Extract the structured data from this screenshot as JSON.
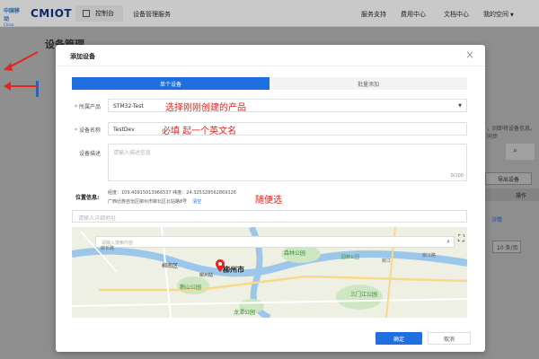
{
  "topbar": {
    "logo_line1": "中国移动",
    "logo_line2": "China Mobile",
    "brand": "CMIOT",
    "console": "控制台",
    "service": "设备管理服务",
    "nav": [
      "服务支持",
      "费用中心",
      "文档中心",
      "我的空间"
    ]
  },
  "page": {
    "title": "设备管理",
    "bg_right_texts": [
      "，则即将设备信息。同步",
      "导出设备",
      "操作",
      "详情",
      "10 条/页"
    ]
  },
  "modal": {
    "title": "添加设备",
    "close": "×",
    "tabs": [
      "单个设备",
      "批量添加"
    ],
    "product_label": "所属产品",
    "product_value": "STM32-Test",
    "device_name_label": "设备名称",
    "device_name_value": "TestDev",
    "desc_label": "设备描述",
    "desc_placeholder": "请输入描述信息",
    "desc_counter": "0/100",
    "location_label": "位置信息:",
    "coords": "经度：109.40915013966537  纬度：24.325328562869326",
    "address": "广西壮族自治区柳州市柳北区北站路8号",
    "clear": "清空",
    "address_placeholder": "请输入详细地址",
    "map_search_placeholder": "请输入搜索内容",
    "ok": "确定",
    "cancel": "取消"
  },
  "annotations": {
    "product": "选择刚刚创建的产品",
    "name": "必填 起一个英文名",
    "location": "随便选"
  },
  "map": {
    "labels": [
      "柳南区",
      "柳州市",
      "森林公园",
      "鹅山公园",
      "龙潭公园",
      "柳州站",
      "三门江公园",
      "柳江",
      "柳长路",
      "柳江路",
      "园林公园"
    ]
  },
  "colors": {
    "primary": "#1f6fe0",
    "annotation": "#e0261f",
    "required": "#e34d4d"
  }
}
